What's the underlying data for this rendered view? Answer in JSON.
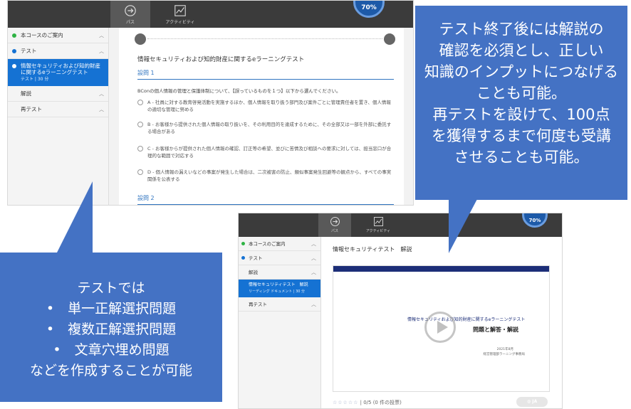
{
  "screenshot1": {
    "nav": [
      {
        "label": "パス",
        "icon": "arrow-right-icon"
      },
      {
        "label": "アクティビティ",
        "icon": "activity-chart-icon"
      }
    ],
    "progress": "70%",
    "sidebar": {
      "course_info": "本コースのご案内",
      "test": "テスト",
      "active_title": "情報セキュリティおよび知的財産に関するeラーニングテスト",
      "active_sub": "テスト | 30 分",
      "explanation": "解説",
      "retest": "再テスト"
    },
    "content": {
      "title": "情報セキュリティおよび知的財産に関するeラーニングテスト",
      "q1_header": "設問 1",
      "q1_text": "BConの個人情報の管理と保護体制について、【誤っているものを１つ】以下から選んでください。",
      "options": [
        "A - 社員に対する教育啓発活動を実施するほか、個人情報を取り扱う部門及び案件ごとに管理責任者を置き、個人情報の適切な管理に努める",
        "B - お客様から提供された個人情報の取り扱いを、その利用目的を達成するために、その全部又は一部を外部に委託する場合がある",
        "C - お客様からが提供された個人情報の確認、訂正等の希望、並びに苦情及び相談への要求に対しては、担当窓口が合理的な範囲で対応する",
        "D - 個人情報の漏えいなどの事案が発生した場合は、二次被害の防止、類似事案発生回避等の観点から、すべての事実関係を公表する"
      ],
      "q2_header": "設問 2"
    }
  },
  "screenshot2": {
    "nav": [
      {
        "label": "パス",
        "icon": "arrow-right-icon"
      },
      {
        "label": "アクティビティ",
        "icon": "activity-chart-icon"
      }
    ],
    "progress": "70%",
    "sidebar": {
      "course_info": "本コースのご案内",
      "test": "テスト",
      "explanation": "解説",
      "active_title": "情報セキュリティテスト　解説",
      "active_sub": "リーディング ドキュメント | 30 分",
      "retest": "再テスト"
    },
    "content": {
      "title": "情報セキュリティテスト　解説",
      "video_title_1": "情報セキュリティおよび知的財産に関するeラーニングテスト",
      "video_title_2": "問題と解答・解説",
      "video_date": "2021年8月",
      "video_org": "経営管理部ラーニング事務局",
      "rating_score": "0/5",
      "rating_votes": "(0 件の投票)",
      "lang": "JA"
    }
  },
  "callout_left": {
    "line1": "テストでは",
    "bullets": [
      "単一正解選択問題",
      "複数正解選択問題",
      "文章穴埋め問題"
    ],
    "line_last": "などを作成することが可能"
  },
  "callout_right": {
    "lines": [
      "テスト終了後には解説の",
      "確認を必須とし、正しい",
      "知識のインプットにつなげる",
      "ことも可能。",
      "再テストを設けて、100点",
      "を獲得するまで何度も受講",
      "させることも可能。"
    ]
  },
  "colors": {
    "callout": "#4472c4",
    "topbar": "#3b3b3b",
    "active": "#1572d3"
  }
}
